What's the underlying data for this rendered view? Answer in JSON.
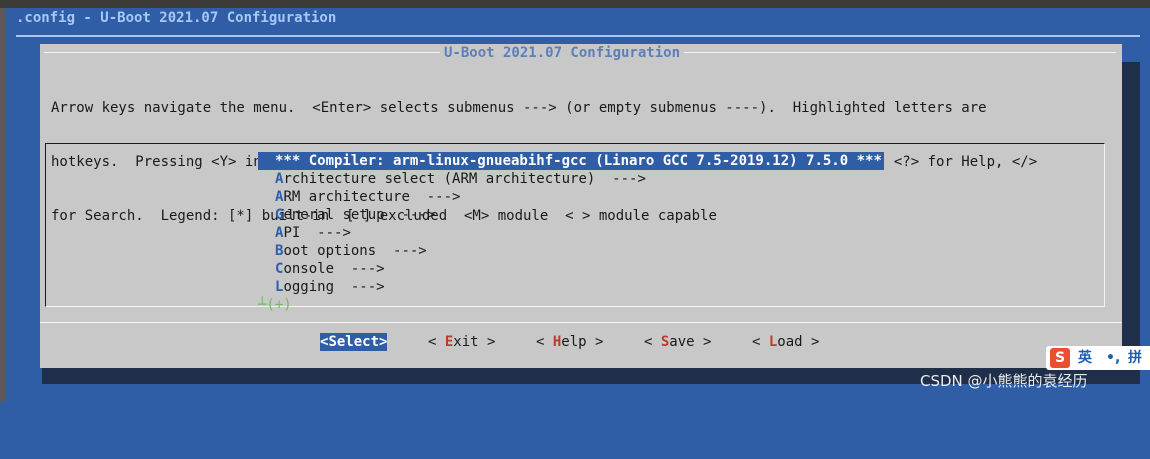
{
  "window": {
    "back_title": ".config - U-Boot 2021.07 Configuration"
  },
  "dialog": {
    "title": "U-Boot 2021.07 Configuration",
    "help_lines": [
      "Arrow keys navigate the menu.  <Enter> selects submenus ---> (or empty submenus ----).  Highlighted letters are",
      "hotkeys.  Pressing <Y> includes, <N> excludes, <M> modularizes features.  Press <Esc><Esc> to exit, <?> for Help, </>",
      "for Search.  Legend: [*] built-in  [ ] excluded  <M> module  < > module capable"
    ]
  },
  "menu": {
    "items": [
      {
        "hot": "",
        "rest": "*** Compiler: arm-linux-gnueabihf-gcc (Linaro GCC 7.5-2019.12) 7.5.0 ***",
        "selected": true
      },
      {
        "hot": "A",
        "rest": "rchitecture select (ARM architecture)  --->",
        "selected": false
      },
      {
        "hot": "A",
        "rest": "RM architecture  --->",
        "selected": false
      },
      {
        "hot": "G",
        "rest": "eneral setup  --->",
        "selected": false
      },
      {
        "hot": "A",
        "rest": "PI  --->",
        "selected": false
      },
      {
        "hot": "B",
        "rest": "oot options  --->",
        "selected": false
      },
      {
        "hot": "C",
        "rest": "onsole  --->",
        "selected": false
      },
      {
        "hot": "L",
        "rest": "ogging  --->",
        "selected": false
      }
    ],
    "more_indicator": "┴(+)"
  },
  "buttons": [
    {
      "pre": "<",
      "hot": "S",
      "post": "elect>",
      "active": true
    },
    {
      "pre": "< ",
      "hot": "E",
      "post": "xit >",
      "active": false
    },
    {
      "pre": "< ",
      "hot": "H",
      "post": "elp >",
      "active": false
    },
    {
      "pre": "< ",
      "hot": "S",
      "post": "ave >",
      "active": false
    },
    {
      "pre": "< ",
      "hot": "L",
      "post": "oad >",
      "active": false
    }
  ],
  "ime": {
    "logo": "S",
    "lang": "英",
    "punct": "•,",
    "mode": "拼"
  },
  "watermark": "CSDN @小熊熊的袁经历",
  "colors": {
    "background": "#2f5ea7",
    "dialog": "#c8c8c8",
    "highlight": "#2f5ea7",
    "hotkey_button": "#c0392b",
    "scroll_indicator": "#6fc05a"
  }
}
